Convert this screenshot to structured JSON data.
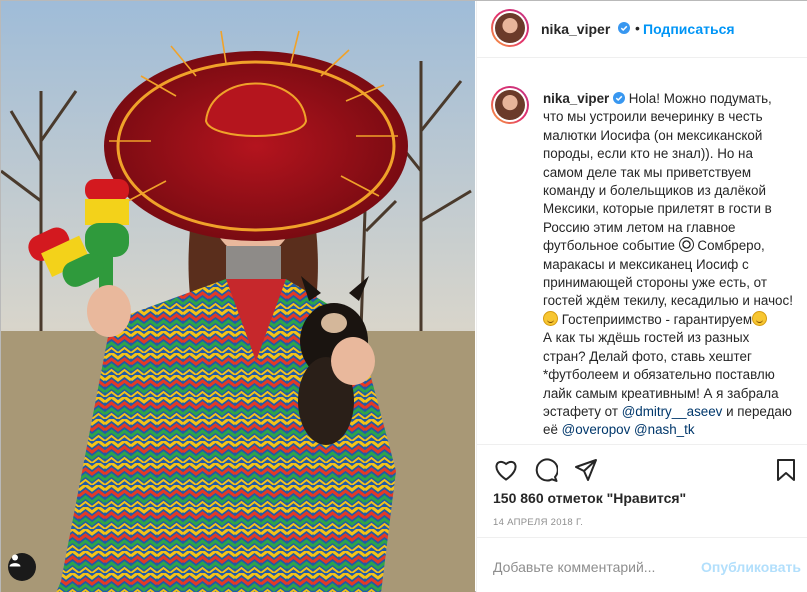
{
  "post": {
    "username": "nika_viper",
    "follow_label": "Подписаться",
    "header_separator": "•",
    "caption": {
      "username": "nika_viper",
      "p1": "Hola! Можно подумать, что мы устроили вечеринку в честь малютки Иосифа (он мексиканской породы, если кто не знал)). Но на самом деле так мы приветствуем команду и болельщиков из далёкой Мексики, которые прилетят в гости в Россию этим летом на главное футбольное событие ",
      "p2": " Сомбреро, маракасы и мексиканец Иосиф с принимающей стороны уже есть, от гостей ждём текилу, кесадилью и начос! ",
      "p3": " Гостеприимство - гарантируем",
      "p4": "А как ты ждёшь гостей из разных стран? Делай фото, ставь хештег *футболеем и обязательно поставлю лайк самым креативным! А я забрала эстафету от ",
      "mention1": "@dmitry__aseev",
      "p5": " и передаю её ",
      "mention2": "@overopov",
      "p6": " ",
      "mention3": "@nash_tk"
    },
    "likes_text": "150 860 отметок \"Нравится\"",
    "date_text": "14 АПРЕЛЯ 2018 Г.",
    "comment_placeholder": "Добавьте комментарий...",
    "publish_label": "Опубликовать",
    "icons": {
      "like": "heart-icon",
      "comment": "comment-icon",
      "share": "share-icon",
      "save": "bookmark-icon",
      "verified": "verified-badge-icon",
      "tag": "user-tag-icon"
    },
    "colors": {
      "link": "#0095f6",
      "mention": "#00376b",
      "muted": "#8e8e8e",
      "publish_disabled": "#b2dffc"
    }
  }
}
